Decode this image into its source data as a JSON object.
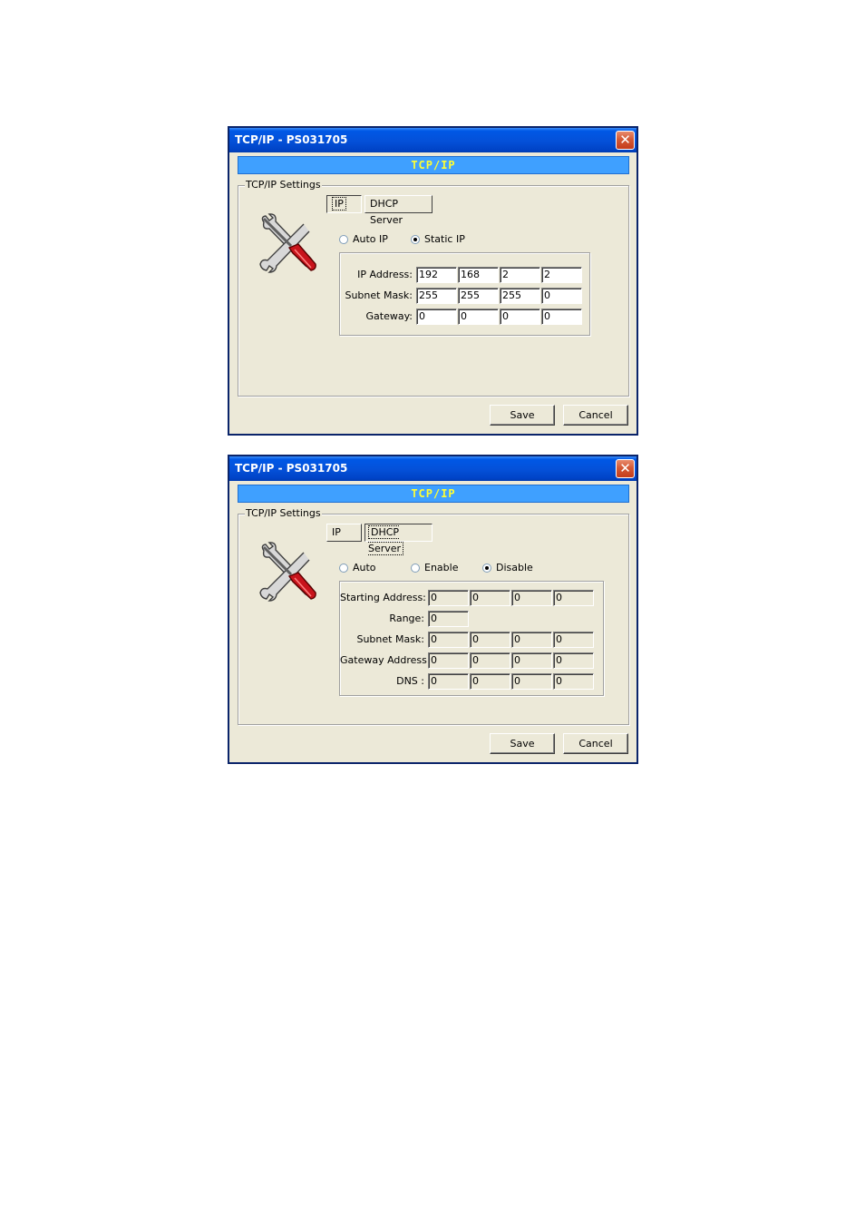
{
  "dialog1": {
    "title": "TCP/IP - PS031705",
    "close": "✕",
    "banner": "TCP/IP",
    "group_label": "TCP/IP Settings",
    "tabs": [
      "IP",
      "DHCP Server"
    ],
    "active_tab": "IP",
    "radios": [
      {
        "label": "Auto IP",
        "selected": false
      },
      {
        "label": "Static IP",
        "selected": true
      }
    ],
    "rows": [
      {
        "label": "IP Address:",
        "values": [
          "192",
          "168",
          "2",
          "2"
        ]
      },
      {
        "label": "Subnet Mask:",
        "values": [
          "255",
          "255",
          "255",
          "0"
        ]
      },
      {
        "label": "Gateway:",
        "values": [
          "0",
          "0",
          "0",
          "0"
        ]
      }
    ],
    "save_label": "Save",
    "cancel_label": "Cancel"
  },
  "dialog2": {
    "title": "TCP/IP - PS031705",
    "close": "✕",
    "banner": "TCP/IP",
    "group_label": "TCP/IP Settings",
    "tabs": [
      "IP",
      "DHCP Server"
    ],
    "active_tab": "DHCP Server",
    "radios": [
      {
        "label": "Auto",
        "selected": false
      },
      {
        "label": "Enable",
        "selected": false
      },
      {
        "label": "Disable",
        "selected": true
      }
    ],
    "rows": [
      {
        "label": "Starting Address:",
        "values": [
          "0",
          "0",
          "0",
          "0"
        ]
      },
      {
        "label": "Range:",
        "values": [
          "0"
        ]
      },
      {
        "label": "Subnet Mask:",
        "values": [
          "0",
          "0",
          "0",
          "0"
        ]
      },
      {
        "label": "Gateway Address:",
        "values": [
          "0",
          "0",
          "0",
          "0"
        ]
      },
      {
        "label": "DNS :",
        "values": [
          "0",
          "0",
          "0",
          "0"
        ]
      }
    ],
    "save_label": "Save",
    "cancel_label": "Cancel"
  }
}
